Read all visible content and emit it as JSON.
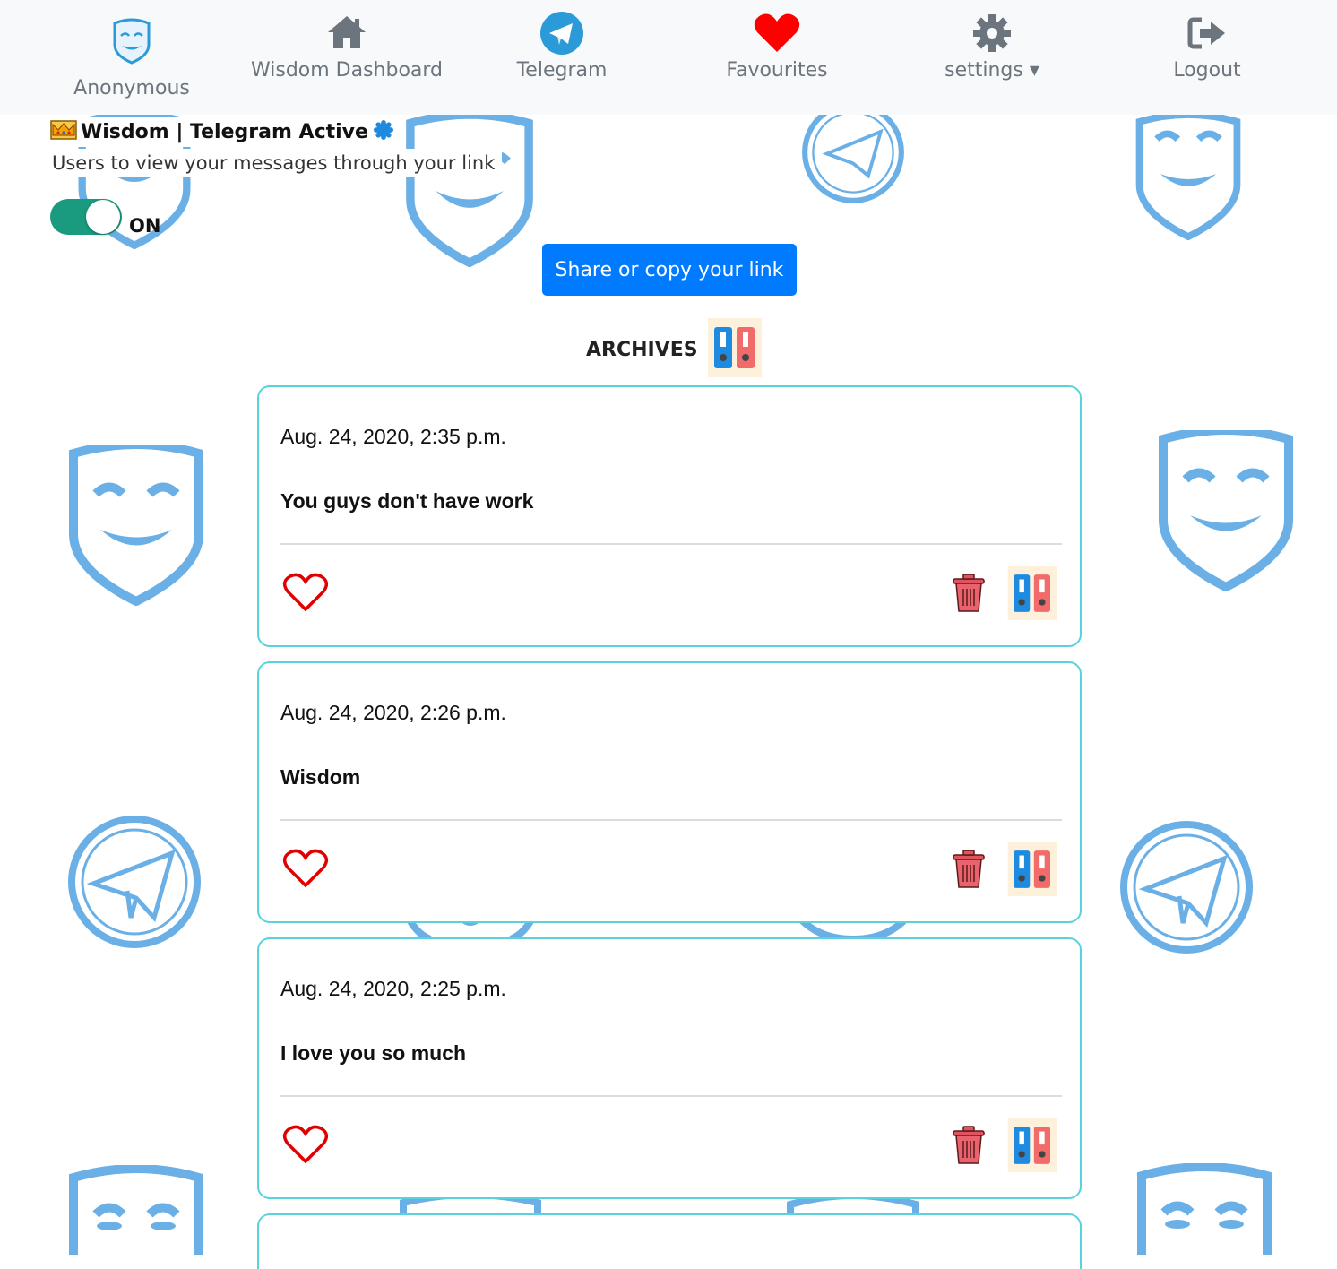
{
  "nav": {
    "brand_label": "Anonymous",
    "items": [
      {
        "label": "Wisdom Dashboard",
        "icon": "home-icon"
      },
      {
        "label": "Telegram",
        "icon": "telegram-icon"
      },
      {
        "label": "Favourites",
        "icon": "heart-icon"
      },
      {
        "label": "settings ▾",
        "icon": "gear-icon"
      },
      {
        "label": "Logout",
        "icon": "logout-icon"
      }
    ]
  },
  "header": {
    "title": "Wisdom | Telegram Active",
    "subtitle": "Users to view your messages through your link",
    "toggle_label": "ON",
    "toggle_state": "on"
  },
  "share_button_label": "Share or copy your link",
  "archives_heading": "ARCHIVES",
  "messages": [
    {
      "date": "Aug. 24, 2020, 2:35 p.m.",
      "text": "You guys don't have work"
    },
    {
      "date": "Aug. 24, 2020, 2:26 p.m.",
      "text": "Wisdom"
    },
    {
      "date": "Aug. 24, 2020, 2:25 p.m.",
      "text": "I love you so much"
    }
  ],
  "colors": {
    "accent_blue": "#007bff",
    "toggle_green": "#1a9b7f",
    "card_border": "#5bd1dc",
    "heart_red": "#e00000",
    "telegram_blue": "#2a9bd8",
    "watermark_blue": "#6ab0e6"
  }
}
